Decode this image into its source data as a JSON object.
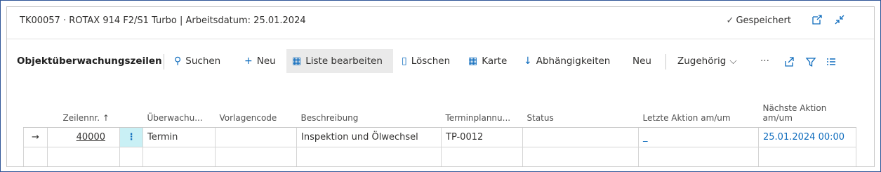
{
  "header": {
    "title": "TK00057 · ROTAX 914 F2/S1 Turbo | Arbeitsdatum: 25.01.2024",
    "saved_label": "Gespeichert",
    "icons": [
      "open-new-window-icon",
      "collapse-icon"
    ]
  },
  "toolbar": {
    "section_title": "Objektüberwachungszeilen",
    "search": "Suchen",
    "new": "Neu",
    "edit_list": "Liste bearbeiten",
    "delete": "Löschen",
    "card": "Karte",
    "dependencies": "Abhängigkeiten",
    "new2": "Neu",
    "related": "Zugehörig",
    "more": "···"
  },
  "grid": {
    "columns": {
      "line_no": "Zeilennr. ↑",
      "monitoring": "Überwachu...",
      "template": "Vorlagencode",
      "description": "Beschreibung",
      "scheduling": "Terminplannu...",
      "status": "Status",
      "last_action": "Letzte Aktion am/um",
      "next_action": "Nächste Aktion am/um"
    },
    "rows": [
      {
        "line_no": "40000",
        "monitoring": "Termin",
        "template": "",
        "description": "Inspektion und Ölwechsel",
        "scheduling": "TP-0012",
        "status": "",
        "last_action": "_",
        "next_action": "25.01.2024 00:00"
      }
    ]
  },
  "colors": {
    "accent": "#0f6cbd",
    "selection": "#c9f0f5"
  }
}
